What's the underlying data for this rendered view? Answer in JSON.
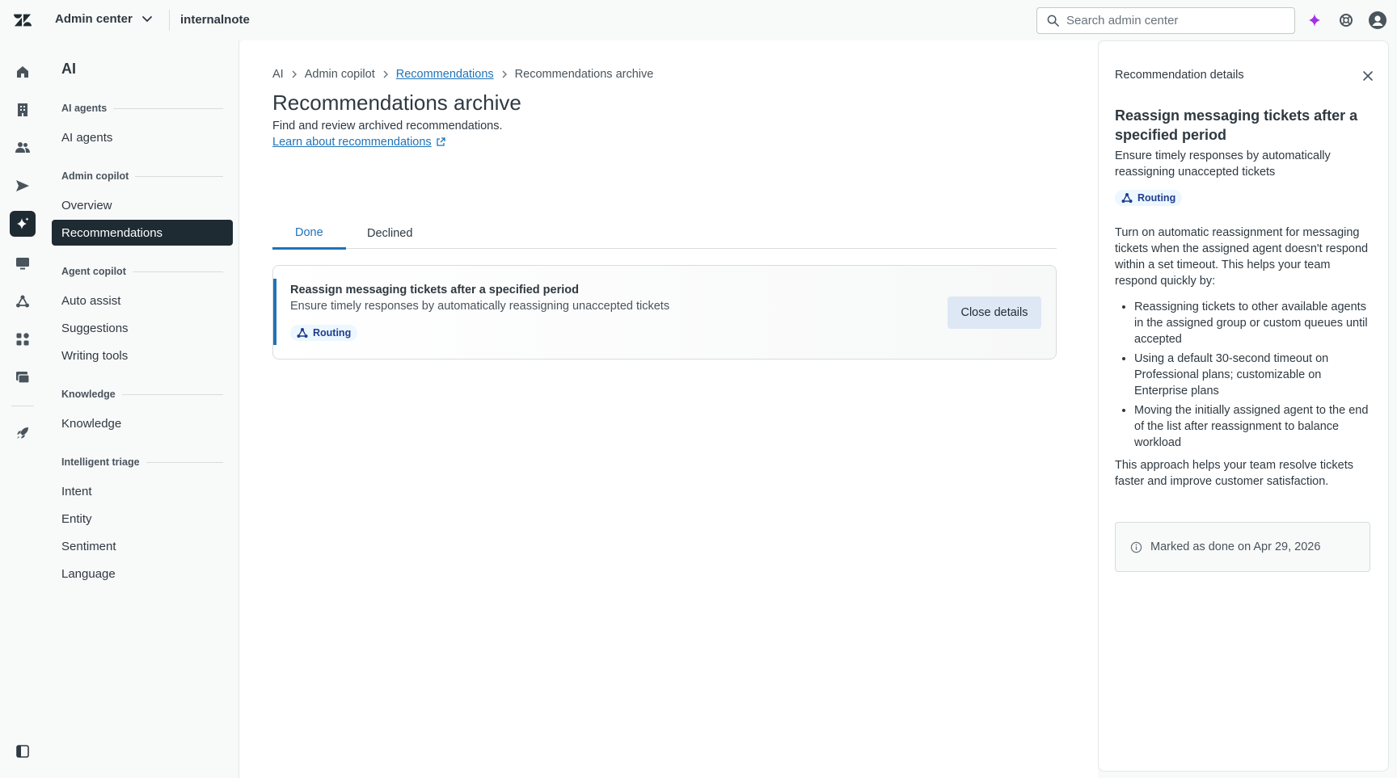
{
  "topbar": {
    "product_label": "Admin center",
    "subdomain": "internalnote",
    "search_placeholder": "Search admin center"
  },
  "subnav": {
    "title": "AI",
    "groups": [
      {
        "label": "AI agents",
        "items": [
          {
            "label": "AI agents"
          }
        ]
      },
      {
        "label": "Admin copilot",
        "items": [
          {
            "label": "Overview"
          },
          {
            "label": "Recommendations"
          }
        ]
      },
      {
        "label": "Agent copilot",
        "items": [
          {
            "label": "Auto assist"
          },
          {
            "label": "Suggestions"
          },
          {
            "label": "Writing tools"
          }
        ]
      },
      {
        "label": "Knowledge",
        "items": [
          {
            "label": "Knowledge"
          }
        ]
      },
      {
        "label": "Intelligent triage",
        "items": [
          {
            "label": "Intent"
          },
          {
            "label": "Entity"
          },
          {
            "label": "Sentiment"
          },
          {
            "label": "Language"
          }
        ]
      }
    ],
    "active_item": "Recommendations"
  },
  "breadcrumb": {
    "items": [
      "AI",
      "Admin copilot",
      "Recommendations",
      "Recommendations archive"
    ]
  },
  "page": {
    "title": "Recommendations archive",
    "description": "Find and review archived recommendations.",
    "learn_link": "Learn about recommendations"
  },
  "tabs": [
    {
      "label": "Done",
      "selected": true
    },
    {
      "label": "Declined",
      "selected": false
    }
  ],
  "recommendation": {
    "title": "Reassign messaging tickets after a specified period",
    "subtitle": "Ensure timely responses by automatically reassigning unaccepted tickets",
    "tag": "Routing",
    "button_label": "Close details"
  },
  "details": {
    "header": "Recommendation details",
    "title": "Reassign messaging tickets after a specified period",
    "subtitle": "Ensure timely responses by automatically reassigning unaccepted tickets",
    "tag": "Routing",
    "intro": "Turn on automatic reassignment for messaging tickets when the assigned agent doesn't respond within a set timeout. This helps your team respond quickly by:",
    "bullets": [
      "Reassigning tickets to other available agents in the assigned group or custom queues until accepted",
      "Using a default 30-second timeout on Professional plans; customizable on Enterprise plans",
      "Moving the initially assigned agent to the end of the list after reassignment to balance workload"
    ],
    "outro": "This approach helps your team resolve tickets faster and improve customer satisfaction.",
    "notice": "Marked as done on Apr 29, 2026"
  },
  "colors": {
    "accent": "#1f73b7",
    "active_nav_bg": "#1f2b33",
    "tag_bg": "#edf7ff",
    "button_bg": "#dde8f4",
    "ai_sparkle": "#a230e8"
  },
  "icons": {
    "rail": [
      "home-icon",
      "building-icon",
      "people-icon",
      "send-icon",
      "ai-sparkle-icon",
      "monitor-icon",
      "routing-icon",
      "apps-icon",
      "workspaces-icon",
      "rocket-icon",
      "sidebar-toggle-icon"
    ],
    "topbar": [
      "zendesk-logo-icon",
      "chevron-down-icon",
      "search-icon",
      "ai-sparkle-icon",
      "help-icon",
      "user-avatar-icon"
    ]
  }
}
